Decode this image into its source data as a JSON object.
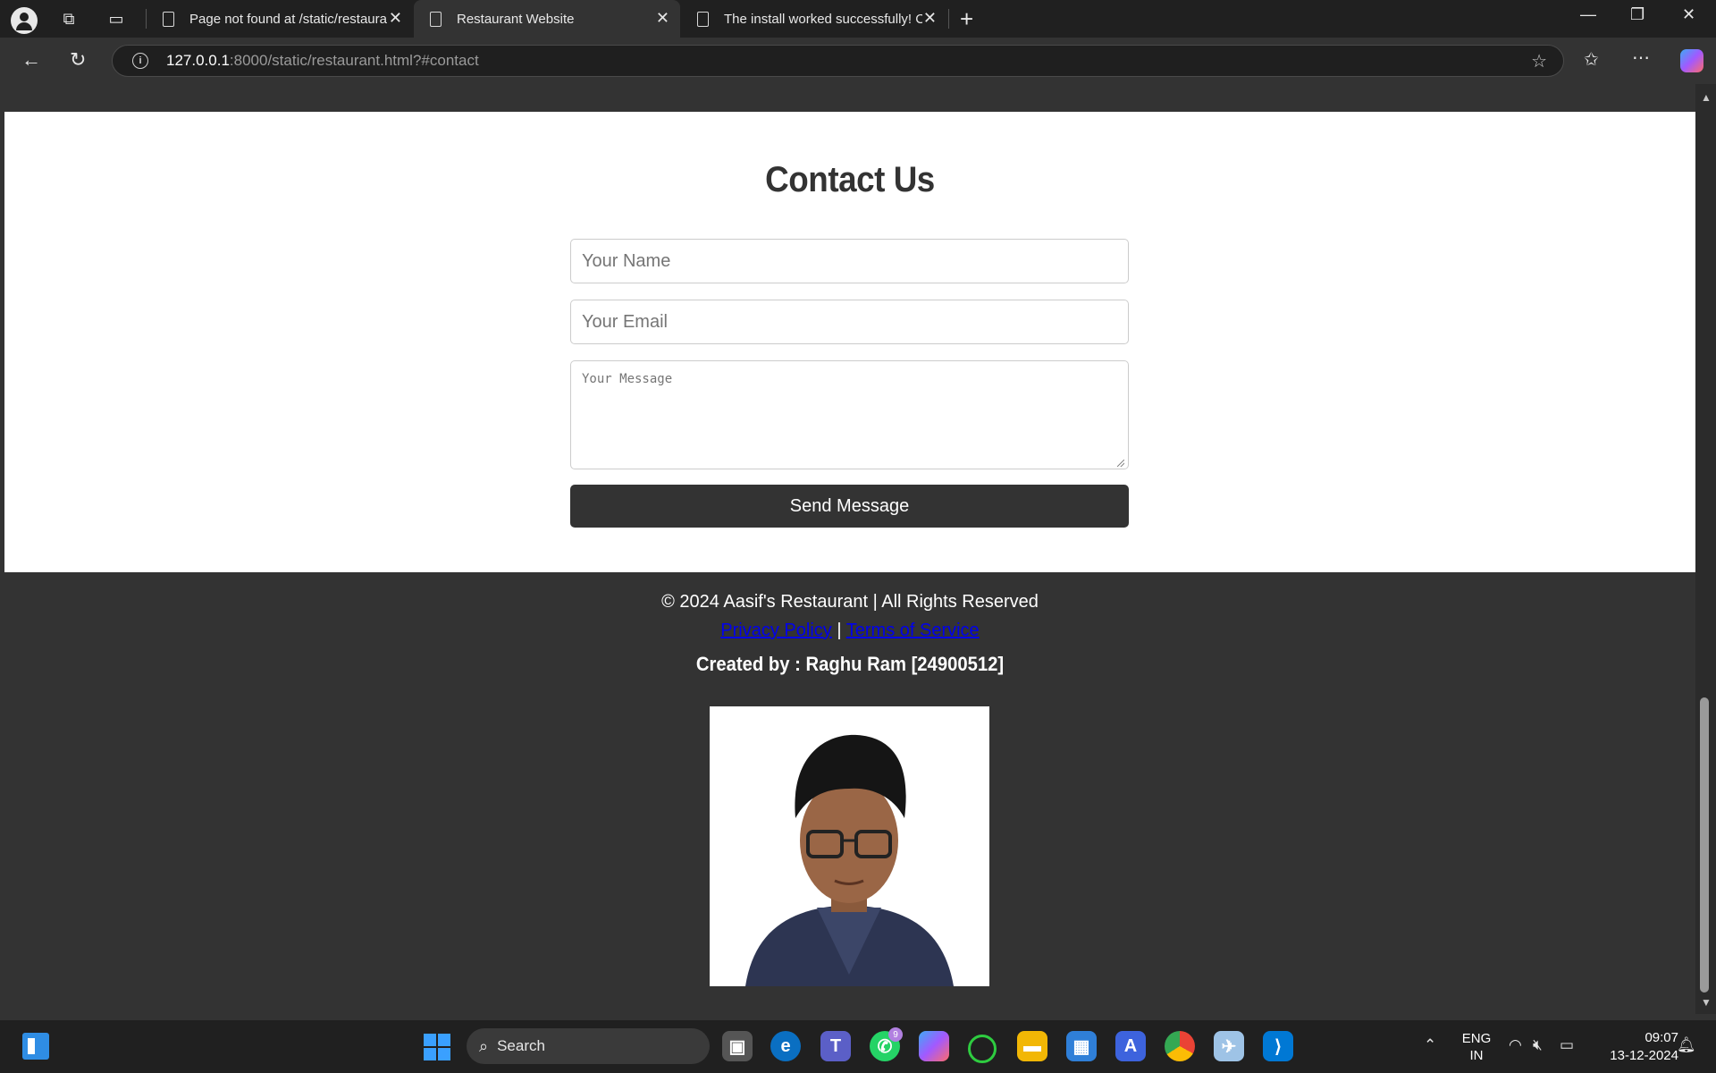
{
  "browser": {
    "tabs": [
      {
        "title": "Page not found at /static/restaura",
        "active": false
      },
      {
        "title": "Restaurant Website",
        "active": true
      },
      {
        "title": "The install worked successfully! Co",
        "active": false
      }
    ],
    "url_host": "127.0.0.1",
    "url_rest": ":8000/static/restaurant.html?#contact"
  },
  "page": {
    "contact_title": "Contact Us",
    "name_placeholder": "Your Name",
    "email_placeholder": "Your Email",
    "message_placeholder": "Your Message",
    "send_label": "Send Message",
    "footer_copyright": "© 2024 Aasif's Restaurant | All Rights Reserved",
    "privacy_link": "Privacy Policy",
    "separator": "|",
    "terms_link": "Terms of Service",
    "created_by": "Created by : Raghu Ram [24900512]"
  },
  "taskbar": {
    "search_label": "Search",
    "whatsapp_badge": "9",
    "lang_line1": "ENG",
    "lang_line2": "IN",
    "time": "09:07",
    "date": "13-12-2024"
  },
  "colors": {
    "page_dark": "#333333",
    "link": "#0000ee",
    "accent_blue": "#3aa0ff"
  }
}
